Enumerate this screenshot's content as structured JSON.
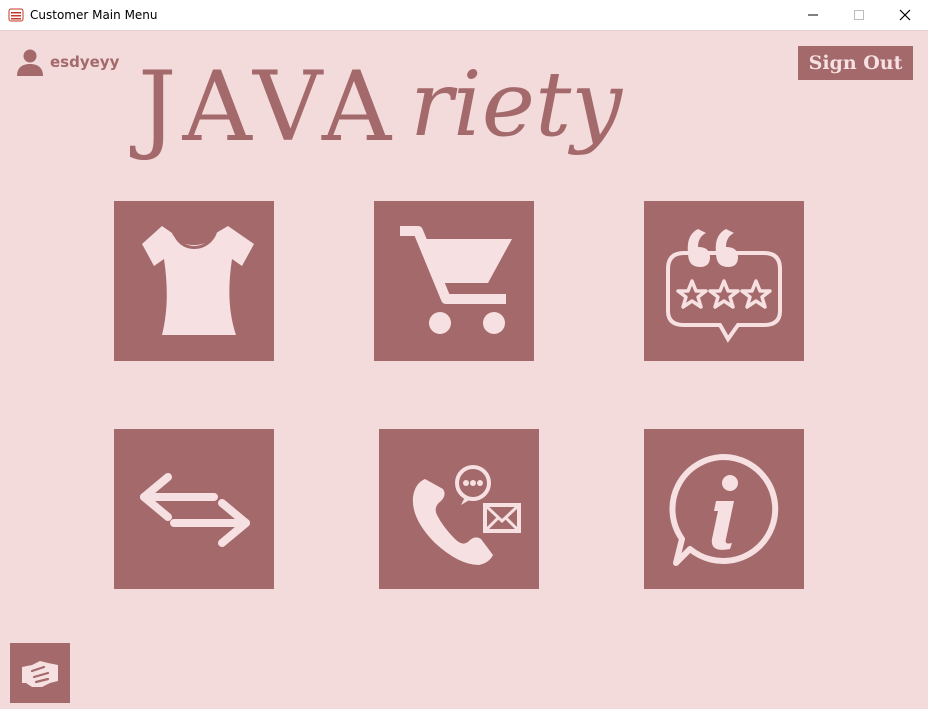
{
  "window": {
    "title": "Customer Main Menu"
  },
  "user": {
    "name": "esdyeyy"
  },
  "header": {
    "sign_out_label": "Sign Out",
    "logo_text_left": "JAVA",
    "logo_text_right": "riety"
  },
  "tiles": [
    {
      "name": "clothing",
      "icon": "shirt-icon"
    },
    {
      "name": "cart",
      "icon": "shopping-cart-icon"
    },
    {
      "name": "reviews",
      "icon": "review-rating-icon"
    },
    {
      "name": "exchange",
      "icon": "exchange-arrows-icon"
    },
    {
      "name": "contact",
      "icon": "phone-message-icon"
    },
    {
      "name": "info",
      "icon": "info-icon"
    }
  ],
  "colors": {
    "background": "#f3dadb",
    "tile": "#a3696b",
    "icon": "#f6e0e1"
  }
}
